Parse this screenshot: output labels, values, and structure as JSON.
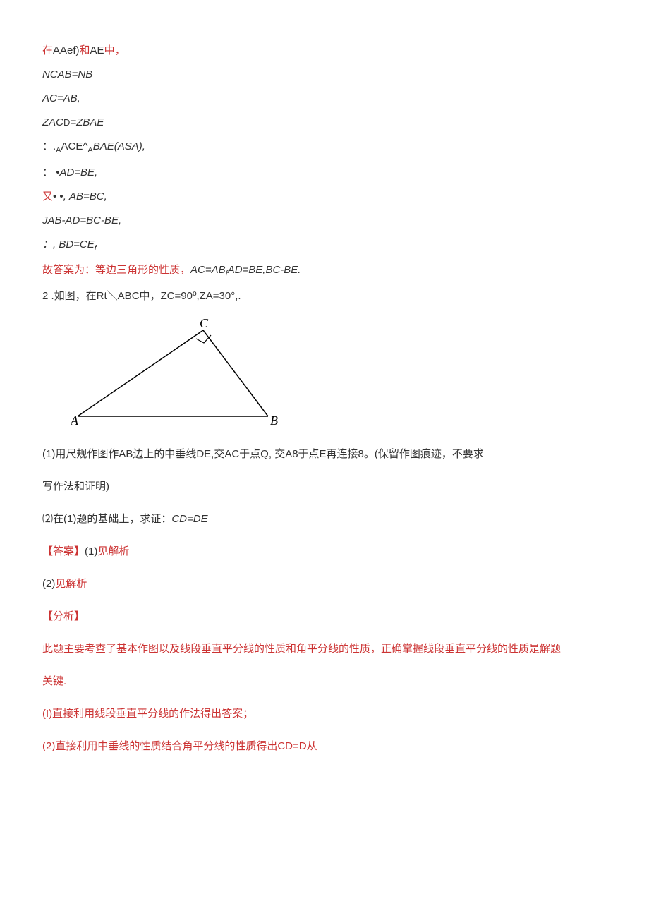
{
  "line01a": "在",
  "line01b": "AAef)",
  "line01c": "和",
  "line01d": "AE",
  "line01e": "中，",
  "line02": "NCAB=NB",
  "line03": "AC=AB,",
  "line04a": "ZAC",
  "line04b": "D",
  "line04c": "=ZBAE",
  "line05a": "：.",
  "line05b": "A",
  "line05c": "ACE^",
  "line05d": "A",
  "line05e": "BAE(ASA),",
  "line06a": "：",
  "line06b": "•AD=BE,",
  "line07a": "又",
  "line07b": "• •",
  "line07c": ", AB=BC,",
  "line08": "JAB-AD=BC-BE,",
  "line09a": "：, BD=CE",
  "line09b": "f",
  "line10a": "故答案为：等边三角形的性质，",
  "line10b": "AC=ΛB",
  "line10bsub": "f",
  "line10c": "AD=BE,BC-BE.",
  "line11": "2 .如图，在Rt＼ABC中，ZC=90º,ZA=30°,.",
  "line12": "(1)用尺规作图作AB边上的中垂线DE,交AC于点Q, 交A8于点E再连接8。(保留作图痕迹，不要求",
  "line13": "写作法和证明)",
  "line14a": "⑵在(1)题的基础上，求证：",
  "line14b": "CD=DE",
  "line15a": "【答案】",
  "line15b": "(1)",
  "line15c": "见解析",
  "line16a": "(2)",
  "line16b": "见解析",
  "line17": "【分析】",
  "line18": "此题主要考查了基本作图以及线段垂直平分线的性质和角平分线的性质，正确掌握线段垂直平分线的性质是解题",
  "line19": "关键.",
  "line20": "(I)直接利用线段垂直平分线的作法得出答案；",
  "line21": " (2)直接利用中垂线的性质结合角平分线的性质得出CD=D从",
  "diagram": {
    "A": "A",
    "B": "B",
    "C": "C"
  }
}
